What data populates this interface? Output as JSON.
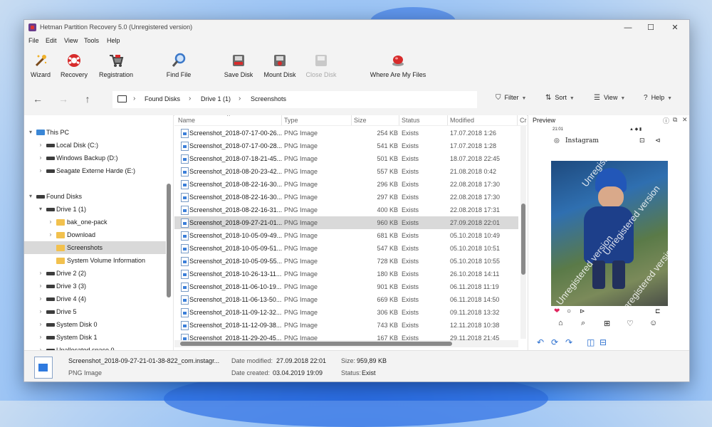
{
  "window": {
    "title": "Hetman Partition Recovery 5.0 (Unregistered version)",
    "controls": [
      "—",
      "☐",
      "✕"
    ]
  },
  "menu": [
    "File",
    "Edit",
    "View",
    "Tools",
    "Help"
  ],
  "ribbon": {
    "wizard": "Wizard",
    "recovery": "Recovery",
    "registration": "Registration",
    "find_file": "Find File",
    "save_disk": "Save Disk",
    "mount_disk": "Mount Disk",
    "close_disk": "Close Disk",
    "where_files": "Where Are My Files"
  },
  "breadcrumb": [
    "Found Disks",
    "Drive 1 (1)",
    "Screenshots"
  ],
  "toolbar": {
    "filter": "Filter",
    "sort": "Sort",
    "view": "View",
    "help": "Help"
  },
  "tree": {
    "this_pc": "This PC",
    "local_disk": "Local Disk (C:)",
    "windows_backup": "Windows Backup (D:)",
    "seagate": "Seagate Externe Harde (E:)",
    "found_disks": "Found Disks",
    "drive1": "Drive 1 (1)",
    "bak": "bak_one-pack",
    "download": "Download",
    "screenshots": "Screenshots",
    "svi": "System Volume Information",
    "drive2": "Drive 2 (2)",
    "drive3": "Drive 3 (3)",
    "drive4": "Drive 4 (4)",
    "drive5": "Drive 5",
    "sysdisk0": "System Disk 0",
    "sysdisk1": "System Disk 1",
    "unalloc": "Unallocated space 0"
  },
  "columns": {
    "name": "Name",
    "type": "Type",
    "size": "Size",
    "status": "Status",
    "modified": "Modified",
    "cr": "Cr"
  },
  "files": [
    {
      "name": "Screenshot_2018-07-17-00-26...",
      "type": "PNG Image",
      "size": "254 KB",
      "status": "Exists",
      "modified": "17.07.2018 1:26"
    },
    {
      "name": "Screenshot_2018-07-17-00-28...",
      "type": "PNG Image",
      "size": "541 KB",
      "status": "Exists",
      "modified": "17.07.2018 1:28"
    },
    {
      "name": "Screenshot_2018-07-18-21-45...",
      "type": "PNG Image",
      "size": "501 KB",
      "status": "Exists",
      "modified": "18.07.2018 22:45"
    },
    {
      "name": "Screenshot_2018-08-20-23-42...",
      "type": "PNG Image",
      "size": "557 KB",
      "status": "Exists",
      "modified": "21.08.2018 0:42"
    },
    {
      "name": "Screenshot_2018-08-22-16-30...",
      "type": "PNG Image",
      "size": "296 KB",
      "status": "Exists",
      "modified": "22.08.2018 17:30"
    },
    {
      "name": "Screenshot_2018-08-22-16-30...",
      "type": "PNG Image",
      "size": "297 KB",
      "status": "Exists",
      "modified": "22.08.2018 17:30"
    },
    {
      "name": "Screenshot_2018-08-22-16-31...",
      "type": "PNG Image",
      "size": "400 KB",
      "status": "Exists",
      "modified": "22.08.2018 17:31"
    },
    {
      "name": "Screenshot_2018-09-27-21-01...",
      "type": "PNG Image",
      "size": "960 KB",
      "status": "Exists",
      "modified": "27.09.2018 22:01"
    },
    {
      "name": "Screenshot_2018-10-05-09-49...",
      "type": "PNG Image",
      "size": "681 KB",
      "status": "Exists",
      "modified": "05.10.2018 10:49"
    },
    {
      "name": "Screenshot_2018-10-05-09-51...",
      "type": "PNG Image",
      "size": "547 KB",
      "status": "Exists",
      "modified": "05.10.2018 10:51"
    },
    {
      "name": "Screenshot_2018-10-05-09-55...",
      "type": "PNG Image",
      "size": "728 KB",
      "status": "Exists",
      "modified": "05.10.2018 10:55"
    },
    {
      "name": "Screenshot_2018-10-26-13-11...",
      "type": "PNG Image",
      "size": "180 KB",
      "status": "Exists",
      "modified": "26.10.2018 14:11"
    },
    {
      "name": "Screenshot_2018-11-06-10-19...",
      "type": "PNG Image",
      "size": "901 KB",
      "status": "Exists",
      "modified": "06.11.2018 11:19"
    },
    {
      "name": "Screenshot_2018-11-06-13-50...",
      "type": "PNG Image",
      "size": "669 KB",
      "status": "Exists",
      "modified": "06.11.2018 14:50"
    },
    {
      "name": "Screenshot_2018-11-09-12-32...",
      "type": "PNG Image",
      "size": "306 KB",
      "status": "Exists",
      "modified": "09.11.2018 13:32"
    },
    {
      "name": "Screenshot_2018-11-12-09-38...",
      "type": "PNG Image",
      "size": "743 KB",
      "status": "Exists",
      "modified": "12.11.2018 10:38"
    },
    {
      "name": "Screenshot_2018-11-29-20-45...",
      "type": "PNG Image",
      "size": "167 KB",
      "status": "Exists",
      "modified": "29.11.2018 21:45"
    }
  ],
  "preview": {
    "title": "Preview",
    "status_time": "21:01",
    "app_name": "Instagram",
    "watermark": "Unregistered version"
  },
  "details": {
    "filename": "Screenshot_2018-09-27-21-01-38-822_com.instagr...",
    "filetype": "PNG Image",
    "date_modified_label": "Date modified:",
    "date_modified": "27.09.2018 22:01",
    "date_created_label": "Date created:",
    "date_created": "03.04.2019 19:09",
    "size_label": "Size:",
    "size": "959,89 KB",
    "status_label": "Status:",
    "status": "Exist"
  }
}
